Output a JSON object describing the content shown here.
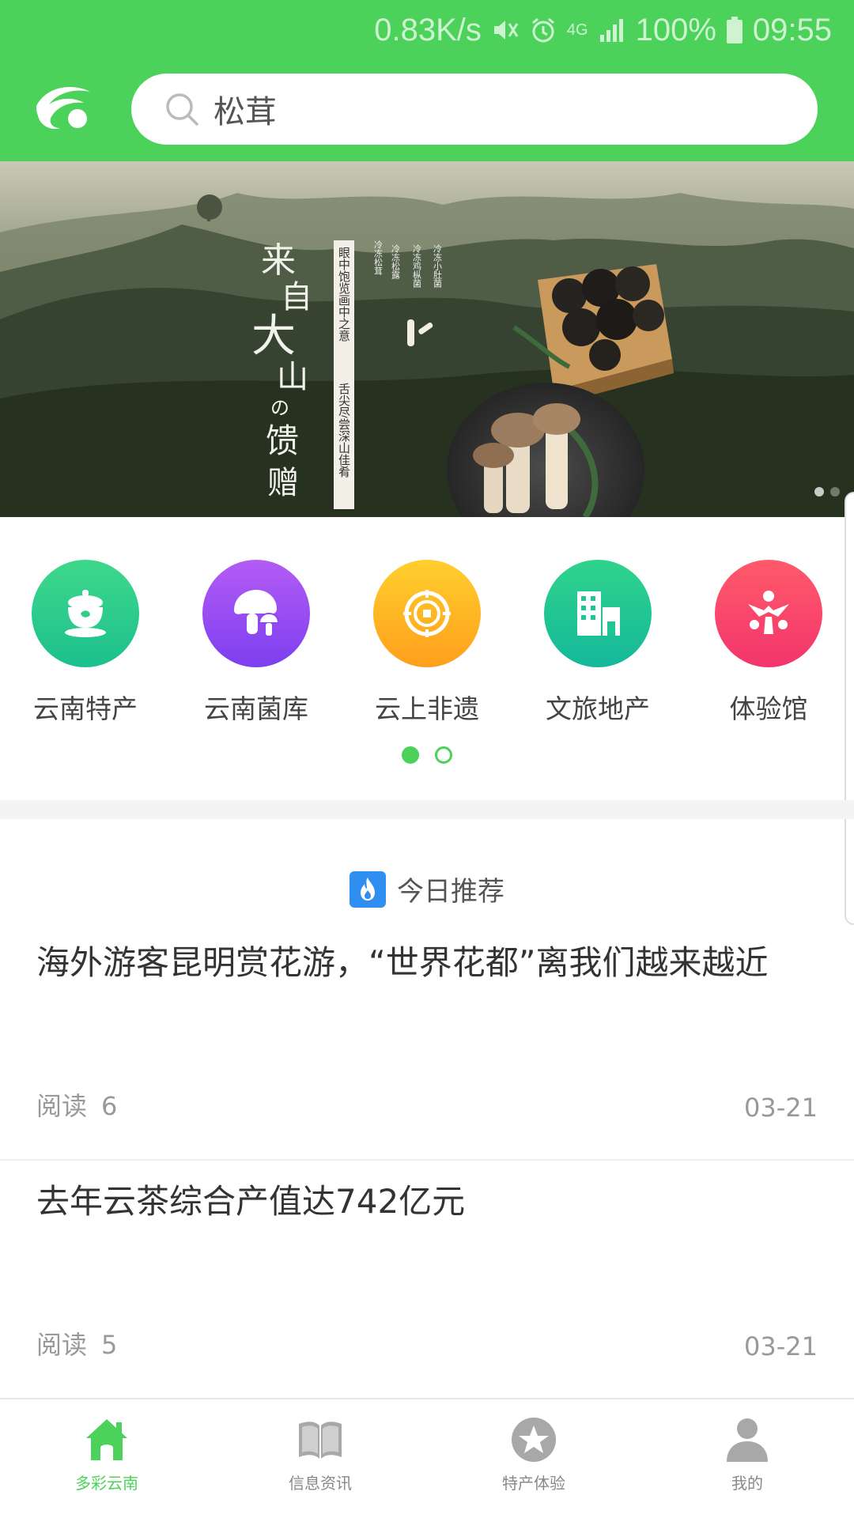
{
  "status_bar": {
    "speed": "0.83K/s",
    "network": "4G",
    "battery": "100%",
    "time": "09:55"
  },
  "search": {
    "placeholder": "松茸",
    "icon": "search-icon"
  },
  "banner": {
    "title_lines": [
      "来",
      "自",
      "大",
      "山",
      "の",
      "馈",
      "赠"
    ],
    "tagline_1": "眼中饱览画中之意",
    "tagline_2": "舌尖尽尝深山佳肴",
    "product_labels": [
      "冷冻松茸",
      "冷冻松露",
      "冷冻鸡枞菌",
      "冷冻小肚菌"
    ],
    "active_slide": 1,
    "slide_count": 2
  },
  "categories": [
    {
      "label": "云南特产",
      "icon": "tea-set-icon",
      "color_from": "#3ed88a",
      "color_to": "#1cc08e"
    },
    {
      "label": "云南菌库",
      "icon": "mushroom-icon",
      "color_from": "#b35cf5",
      "color_to": "#7d3ff0"
    },
    {
      "label": "云上非遗",
      "icon": "coin-icon",
      "color_from": "#ffcf2e",
      "color_to": "#ff9f1c"
    },
    {
      "label": "文旅地产",
      "icon": "building-icon",
      "color_from": "#2fd38b",
      "color_to": "#15b89a"
    },
    {
      "label": "体验馆",
      "icon": "people-icon",
      "color_from": "#ff5a6a",
      "color_to": "#f3356c"
    }
  ],
  "category_pager": {
    "active": 1,
    "count": 2
  },
  "recommend": {
    "title": "今日推荐",
    "icon": "fire-icon"
  },
  "news": [
    {
      "title": "海外游客昆明赏花游，“世界花都”离我们越来越近",
      "read_label": "阅读",
      "reads": "6",
      "date": "03-21"
    },
    {
      "title": "去年云茶综合产值达742亿元",
      "read_label": "阅读",
      "reads": "5",
      "date": "03-21"
    }
  ],
  "tabs": [
    {
      "label": "多彩云南",
      "icon": "home-icon",
      "active": true
    },
    {
      "label": "信息资讯",
      "icon": "book-icon",
      "active": false
    },
    {
      "label": "特产体验",
      "icon": "star-icon",
      "active": false
    },
    {
      "label": "我的",
      "icon": "user-icon",
      "active": false
    }
  ],
  "colors": {
    "brand": "#4cd25a",
    "fire_badge": "#2f8ff0"
  }
}
